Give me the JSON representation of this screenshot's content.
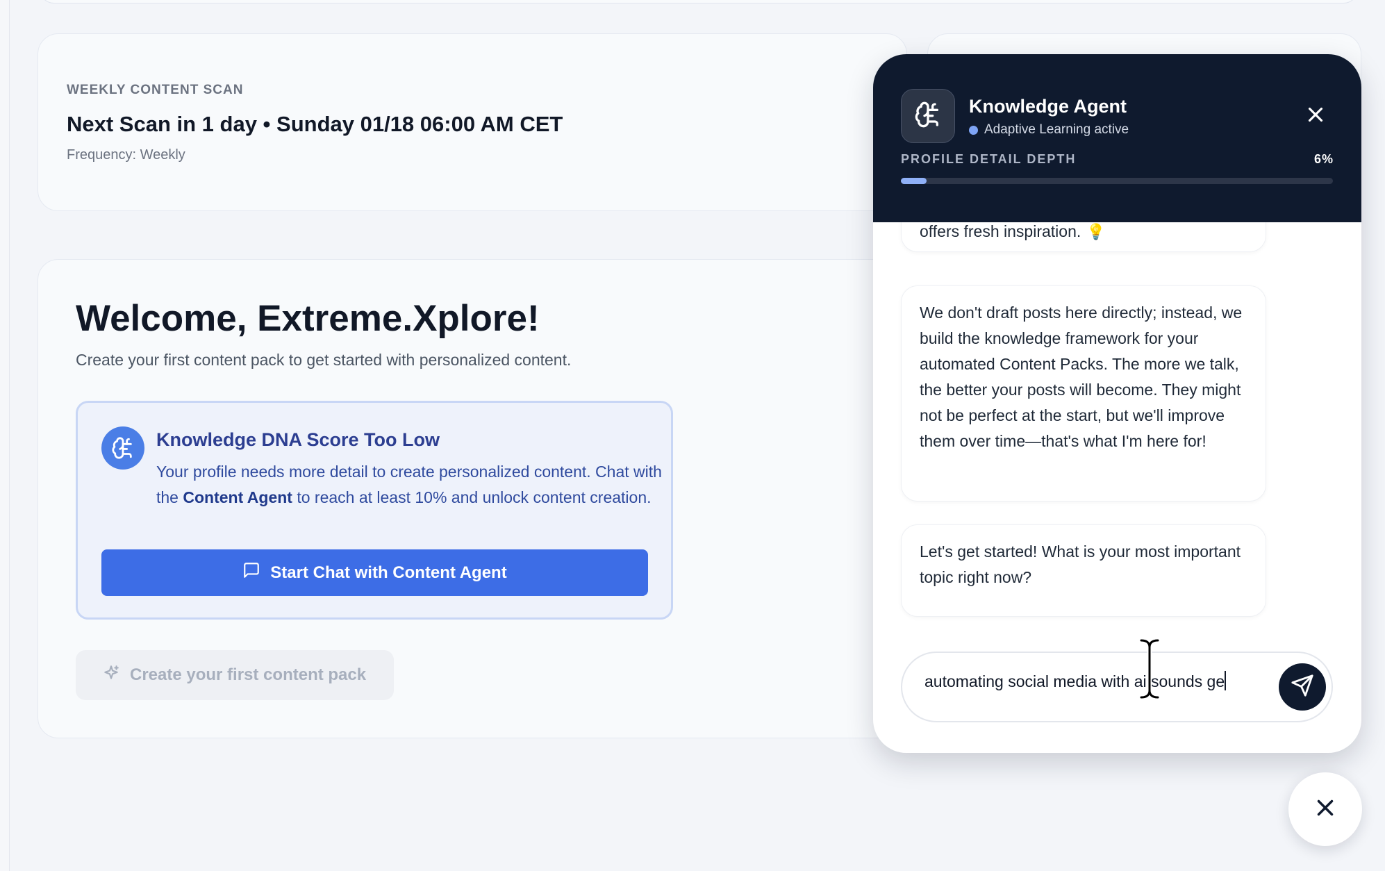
{
  "scan": {
    "label": "WEEKLY CONTENT SCAN",
    "title": "Next Scan in 1 day • Sunday 01/18 06:00 AM CET",
    "frequency": "Frequency: Weekly"
  },
  "welcome": {
    "title": "Welcome, Extreme.Xplore!",
    "subtitle": "Create your first content pack to get started with personalized content.",
    "dna": {
      "icon": "brain-icon",
      "title": "Knowledge DNA Score Too Low",
      "text_part1": "Your profile needs more detail to create personalized content. Chat with the ",
      "text_bold": "Content Agent",
      "text_part2": " to reach at least 10% and unlock content creation.",
      "button_label": "Start Chat with Content Agent",
      "button_icon": "message-square-icon"
    },
    "create_pack": {
      "label": "Create your first content pack",
      "icon": "sparkles-icon"
    }
  },
  "chat": {
    "agent_name": "Knowledge Agent",
    "agent_status": "Adaptive Learning active",
    "depth_label": "PROFILE DETAIL DEPTH",
    "depth_value": "6%",
    "depth_fraction": 0.06,
    "messages": [
      "offers fresh inspiration.",
      "We don't draft posts here directly; instead, we build the knowledge framework for your automated Content Packs. The more we talk, the better your posts will become. They might not be perfect at the start, but we'll improve them over time—that's what I'm here for!",
      "Let's get started! What is your most important topic right now?"
    ],
    "input_value": "automating social media with ai sounds ge"
  },
  "colors": {
    "accent": "#3d6de6",
    "header_bg": "#0f1a2e",
    "depth_fill": "#8fb0f7",
    "dna_bg": "#eef2fb"
  }
}
